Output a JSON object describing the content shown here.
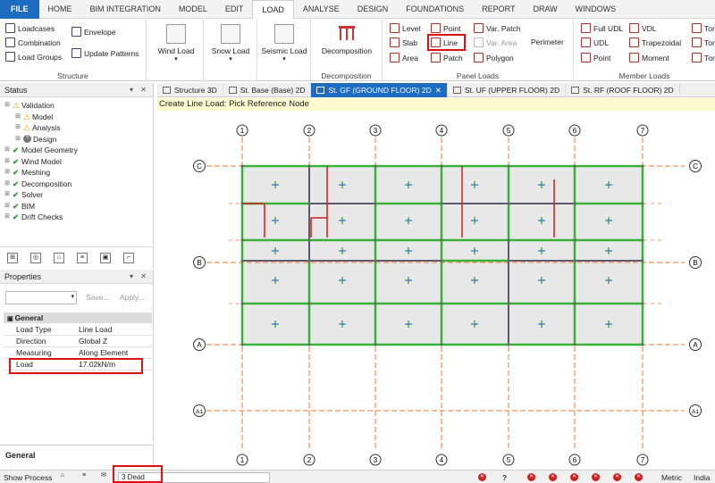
{
  "menu": [
    "FILE",
    "HOME",
    "BIM INTEGRATION",
    "MODEL",
    "EDIT",
    "LOAD",
    "ANALYSE",
    "DESIGN",
    "FOUNDATIONS",
    "REPORT",
    "DRAW",
    "WINDOWS"
  ],
  "ribbon": {
    "structure": {
      "title": "Structure",
      "loadcases": "Loadcases",
      "combination": "Combination",
      "load_groups": "Load Groups",
      "envelope": "Envelope",
      "update_patterns": "Update Patterns"
    },
    "wind_load": "Wind Load",
    "snow_load": "Snow Load",
    "seismic_load": "Seismic Load",
    "decomposition": {
      "btn": "Decomposition",
      "title": "Decomposition"
    },
    "panel_loads": {
      "title": "Panel Loads",
      "level": "Level",
      "point": "Point",
      "var_patch": "Var. Patch",
      "slab": "Slab",
      "line": "Line",
      "var_area": "Var. Area",
      "perimeter": "Perimeter",
      "area": "Area",
      "patch": "Patch",
      "polygon": "Polygon"
    },
    "member_loads": {
      "title": "Member Loads",
      "full_udl": "Full UDL",
      "vdl": "VDL",
      "tor1": "Tor",
      "udl": "UDL",
      "trapezoidal": "Trapezoidal",
      "tor2": "Tor",
      "point": "Point",
      "moment": "Moment",
      "tor3": "Tor"
    }
  },
  "status_panel": {
    "title": "Status",
    "tree": [
      {
        "label": "Validation",
        "icon": "warn",
        "level": 0
      },
      {
        "label": "Model",
        "icon": "warn",
        "level": 1
      },
      {
        "label": "Analysis",
        "icon": "warn",
        "level": 1
      },
      {
        "label": "Design",
        "icon": "q",
        "level": 1
      },
      {
        "label": "Model Geometry",
        "icon": "check",
        "level": 0
      },
      {
        "label": "Wind Model",
        "icon": "check",
        "level": 0
      },
      {
        "label": "Meshing",
        "icon": "check",
        "level": 0
      },
      {
        "label": "Decomposition",
        "icon": "check",
        "level": 0
      },
      {
        "label": "Solver",
        "icon": "check",
        "level": 0
      },
      {
        "label": "BIM",
        "icon": "check",
        "level": 0
      },
      {
        "label": "Drift Checks",
        "icon": "check",
        "level": 0
      }
    ]
  },
  "properties": {
    "title": "Properties",
    "save": "Save...",
    "apply": "Apply...",
    "section": "General",
    "rows": [
      {
        "key": "Load Type",
        "value": "Line Load"
      },
      {
        "key": "Direction",
        "value": "Global Z"
      },
      {
        "key": "Measuring",
        "value": "Along Element"
      },
      {
        "key": "Load",
        "value": "17.02kN/m"
      }
    ]
  },
  "general_panel": "General",
  "tabs": [
    "Structure 3D",
    "St. Base (Base) 2D",
    "St. GF (GROUND FLOOR) 2D",
    "St. UF (UPPER FLOOR) 2D",
    "St. RF (ROOF FLOOR) 2D"
  ],
  "prompt": "Create Line Load: Pick Reference Node",
  "grid": {
    "columns": [
      "1",
      "2",
      "3",
      "4",
      "5",
      "6",
      "7"
    ],
    "rows": [
      "C",
      "B",
      "A",
      "A1"
    ]
  },
  "bottom": {
    "show_process": "Show Process",
    "loadcase": "3 Dead",
    "units": "Metric",
    "region": "India"
  }
}
